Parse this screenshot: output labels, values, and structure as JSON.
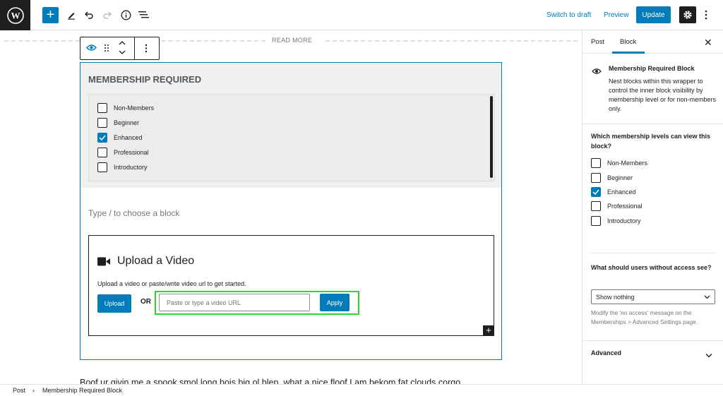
{
  "header": {
    "switch_to_draft": "Switch to draft",
    "preview": "Preview",
    "update": "Update",
    "add_symbol": "+"
  },
  "editor": {
    "read_more": "READ MORE",
    "membership_title": "MEMBERSHIP REQUIRED",
    "levels": [
      {
        "label": "Non-Members",
        "checked": false
      },
      {
        "label": "Beginner",
        "checked": false
      },
      {
        "label": "Enhanced",
        "checked": true
      },
      {
        "label": "Professional",
        "checked": false
      },
      {
        "label": "Introductory",
        "checked": false
      }
    ],
    "block_placeholder": "Type / to choose a block",
    "video": {
      "title": "Upload a Video",
      "description": "Upload a video or paste/write video url to get started.",
      "upload_label": "Upload",
      "or_label": "OR",
      "url_placeholder": "Paste or type a video URL",
      "apply_label": "Apply",
      "add_symbol": "+"
    },
    "paragraph": "Boof ur givin me a spook smol long bois big ol blep, what a nice floof I am bekom fat clouds corgo"
  },
  "sidebar": {
    "tabs": [
      "Post",
      "Block"
    ],
    "active_tab": "Block",
    "close_symbol": "✕",
    "block_title": "Membership Required Block",
    "block_description": "Nest blocks within this wrapper to control the inner block visibility by membership level or for non-members only.",
    "levels_question": "Which membership levels can view this block?",
    "levels": [
      {
        "label": "Non-Members",
        "checked": false
      },
      {
        "label": "Beginner",
        "checked": false
      },
      {
        "label": "Enhanced",
        "checked": true
      },
      {
        "label": "Professional",
        "checked": false
      },
      {
        "label": "Introductory",
        "checked": false
      }
    ],
    "no_access_question": "What should users without access see?",
    "no_access_selected": "Show nothing",
    "no_access_help": "Modify the 'no access' message on the Memberships > Advanced Settings page.",
    "advanced_label": "Advanced"
  },
  "footer": {
    "breadcrumb": [
      "Post",
      "Membership Required Block"
    ],
    "separator": "›"
  },
  "colors": {
    "accent": "#007cba",
    "highlight": "#2bd92b",
    "dark": "#1e1e1e"
  }
}
